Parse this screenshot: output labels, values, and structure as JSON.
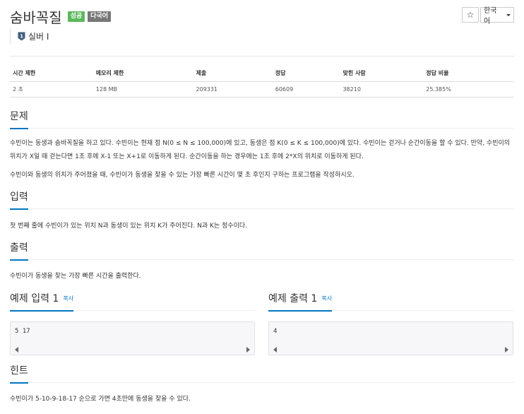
{
  "problem": {
    "title": "숨바꼭질",
    "badges": [
      "성공",
      "다국어"
    ],
    "tier": "실버 I"
  },
  "toolbar": {
    "star_icon": "☆",
    "language": "한국어"
  },
  "info_table": {
    "headers": [
      "시간 제한",
      "메모리 제한",
      "제출",
      "정답",
      "맞힌 사람",
      "정답 비율"
    ],
    "values": [
      "2 초",
      "128 MB",
      "209331",
      "60609",
      "38210",
      "25.385%"
    ]
  },
  "sections": {
    "description": {
      "title": "문제",
      "p1": "수빈이는 동생과 숨바꼭질을 하고 있다. 수빈이는 현재 점 N(0 ≤ N ≤ 100,000)에 있고, 동생은 점 K(0 ≤ K ≤ 100,000)에 있다. 수빈이는 걷거나 순간이동을 할 수 있다. 만약, 수빈이의 위치가 X일 때 걷는다면 1초 후에 X-1 또는 X+1로 이동하게 된다. 순간이동을 하는 경우에는 1초 후에 2*X의 위치로 이동하게 된다.",
      "p2": "수빈이와 동생의 위치가 주어졌을 때, 수빈이가 동생을 찾을 수 있는 가장 빠른 시간이 몇 초 후인지 구하는 프로그램을 작성하시오."
    },
    "input": {
      "title": "입력",
      "text": "첫 번째 줄에 수빈이가 있는 위치 N과 동생이 있는 위치 K가 주어진다. N과 K는 정수이다."
    },
    "output": {
      "title": "출력",
      "text": "수빈이가 동생을 찾는 가장 빠른 시간을 출력한다."
    },
    "hint": {
      "title": "힌트",
      "text": "수빈이가 5-10-9-18-17 순으로 가면 4초만에 동생을 찾을 수 있다."
    }
  },
  "samples": {
    "input": {
      "title": "예제 입력 1",
      "copy": "복사",
      "content": "5 17"
    },
    "output": {
      "title": "예제 출력 1",
      "copy": "복사",
      "content": "4"
    }
  },
  "colors": {
    "accent": "#0076c0",
    "badge_success": "#5cb85c",
    "badge_multilang": "#777777"
  }
}
